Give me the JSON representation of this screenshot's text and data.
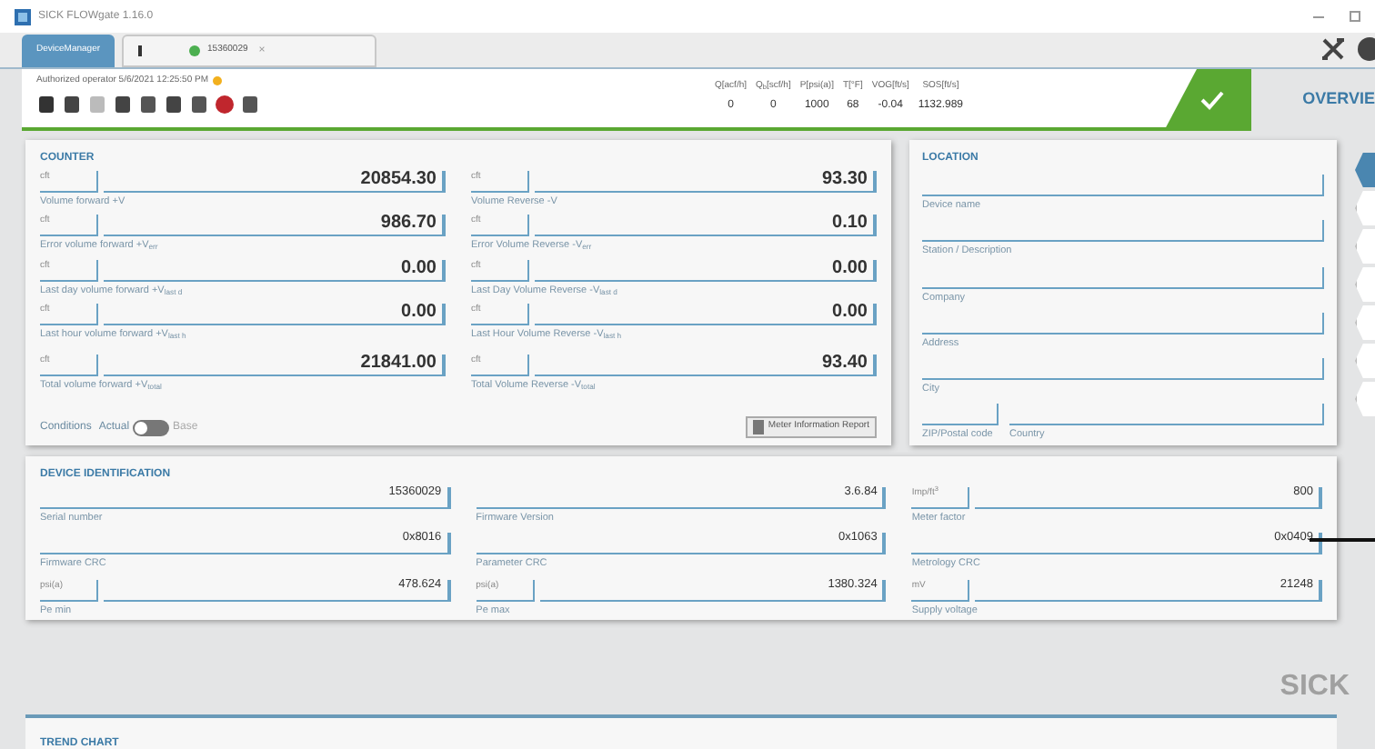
{
  "window": {
    "title": "SICK FLOWgate 1.16.0"
  },
  "tabs": [
    {
      "label": "DeviceManager",
      "selected": true
    },
    {
      "label": "15360029",
      "selected": false,
      "close": "×"
    }
  ],
  "header": {
    "operator": "Authorized operator",
    "timestamp": "5/6/2021 12:25:50 PM",
    "readings": [
      {
        "label": "Q[acf/h]",
        "value": "0"
      },
      {
        "label": "Q$_{b}$[scf/h]",
        "value": "0"
      },
      {
        "label": "P[psi(a)]",
        "value": "1000"
      },
      {
        "label": "T[°F]",
        "value": "68"
      },
      {
        "label": "VOG[ft/s]",
        "value": "-0.04"
      },
      {
        "label": "SOS[ft/s]",
        "value": "1132.989"
      }
    ],
    "view": "OVERVIE"
  },
  "counter": {
    "title": "COUNTER",
    "columns": [
      [
        {
          "unit": "cft",
          "value": "20854.30",
          "label": "Volume forward +V"
        },
        {
          "unit": "cft",
          "value": "986.70",
          "label": "Error volume forward +V$_{err}$"
        },
        {
          "unit": "cft",
          "value": "0.00",
          "label": "Last day volume forward +V$_{last d}$"
        },
        {
          "unit": "cft",
          "value": "0.00",
          "label": "Last hour volume forward +V$_{last h}$"
        },
        {
          "unit": "cft",
          "value": "21841.00",
          "label": "Total volume forward +V$_{total}$"
        }
      ],
      [
        {
          "unit": "cft",
          "value": "93.30",
          "label": "Volume Reverse -V"
        },
        {
          "unit": "cft",
          "value": "0.10",
          "label": "Error Volume Reverse -V$_{err}$"
        },
        {
          "unit": "cft",
          "value": "0.00",
          "label": "Last Day Volume Reverse -V$_{last d}$"
        },
        {
          "unit": "cft",
          "value": "0.00",
          "label": "Last Hour Volume Reverse -V$_{last h}$"
        },
        {
          "unit": "cft",
          "value": "93.40",
          "label": "Total Volume Reverse -V$_{total}$"
        }
      ]
    ],
    "conditions": {
      "label": "Conditions",
      "off_label": "Actual",
      "on_label": "Base",
      "on": false
    },
    "report_button": "Meter Information Report"
  },
  "location": {
    "title": "LOCATION",
    "rows": [
      [
        "Device name"
      ],
      [
        "Station / Description"
      ],
      [
        "Company"
      ],
      [
        "Address"
      ],
      [
        "City"
      ],
      [
        "ZIP/Postal code",
        "Country"
      ]
    ]
  },
  "device_identification": {
    "title": "DEVICE IDENTIFICATION",
    "fields": [
      {
        "value": "15360029",
        "label": "Serial number"
      },
      {
        "value": "3.6.84",
        "label": "Firmware Version"
      },
      {
        "unit": "Imp/ft$^{3}$",
        "value": "800",
        "label": "Meter factor"
      },
      {
        "value": "0x8016",
        "label": "Firmware CRC"
      },
      {
        "value": "0x1063",
        "label": "Parameter CRC"
      },
      {
        "value": "0x0409",
        "label": "Metrology CRC"
      },
      {
        "unit": "psi(a)",
        "value": "478.624",
        "label": "Pe min"
      },
      {
        "unit": "psi(a)",
        "value": "1380.324",
        "label": "Pe max"
      },
      {
        "unit": "mV",
        "value": "21248",
        "label": "Supply voltage"
      }
    ]
  },
  "side_nav": [
    {
      "selected": true
    },
    {
      "selected": false
    },
    {
      "selected": false
    },
    {
      "selected": false
    },
    {
      "selected": false
    },
    {
      "selected": false
    },
    {
      "selected": false
    }
  ],
  "logo": "SICK",
  "trend_chart": {
    "title": "TREND CHART"
  }
}
